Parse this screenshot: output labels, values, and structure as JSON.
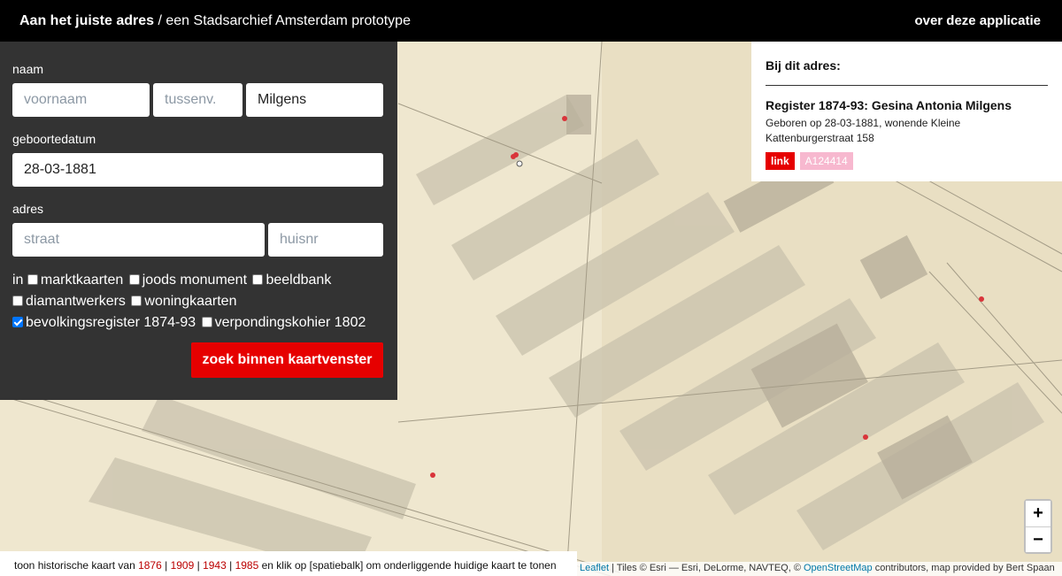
{
  "header": {
    "brand_bold": "Aan het juiste adres",
    "brand_rest": " / een Stadsarchief Amsterdam prototype",
    "about_link": "over deze applicatie"
  },
  "search": {
    "name_label": "naam",
    "first_name_placeholder": "voornaam",
    "infix_placeholder": "tussenv.",
    "last_name_value": "Milgens",
    "dob_label": "geboortedatum",
    "dob_value": "28-03-1881",
    "address_label": "adres",
    "street_placeholder": "straat",
    "number_placeholder": "huisnr",
    "in_label": "in",
    "sources": [
      {
        "label": "marktkaarten",
        "checked": false
      },
      {
        "label": "joods monument",
        "checked": false
      },
      {
        "label": "beeldbank",
        "checked": false
      },
      {
        "label": "diamantwerkers",
        "checked": false
      },
      {
        "label": "woningkaarten",
        "checked": false
      },
      {
        "label": "bevolkingsregister 1874-93",
        "checked": true
      },
      {
        "label": "verpondingskohier 1802",
        "checked": false
      }
    ],
    "submit_label": "zoek binnen kaartvenster"
  },
  "result": {
    "heading": "Bij dit adres:",
    "title": "Register 1874-93: Gesina Antonia Milgens",
    "description": "Geboren op 28-03-1881, wonende Kleine Kattenburgerstraat 158",
    "link_label": "link",
    "id_label": "A124414"
  },
  "zoom": {
    "in_label": "+",
    "out_label": "−"
  },
  "history_bar": {
    "prefix": "toon historische kaart van ",
    "years": [
      "1876",
      "1909",
      "1943",
      "1985"
    ],
    "separator": " | ",
    "suffix": " en klik op [spatiebalk] om onderliggende huidige kaart te tonen"
  },
  "attribution": {
    "leaflet": "Leaflet",
    "tiles_text": " | Tiles © Esri — Esri, DeLorme, NAVTEQ, © ",
    "osm": "OpenStreetMap",
    "rest": " contributors, map provided by Bert Spaan"
  },
  "colors": {
    "accent": "#e60000",
    "panel_bg": "#333333",
    "header_bg": "#000000",
    "marker": "#d9343a"
  }
}
